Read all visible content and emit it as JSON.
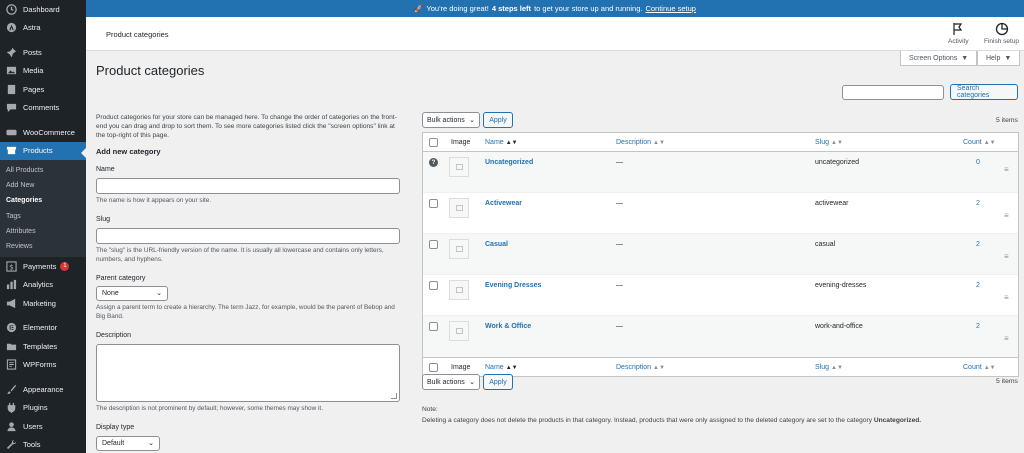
{
  "sidebar": {
    "items": [
      {
        "label": "Dashboard",
        "icon": "dashboard-icon"
      },
      {
        "label": "Astra",
        "icon": "astra-icon"
      },
      {
        "label": "Posts",
        "icon": "pin-icon"
      },
      {
        "label": "Media",
        "icon": "media-icon"
      },
      {
        "label": "Pages",
        "icon": "page-icon"
      },
      {
        "label": "Comments",
        "icon": "comment-icon"
      },
      {
        "label": "WooCommerce",
        "icon": "woocommerce-icon"
      },
      {
        "label": "Products",
        "icon": "archive-icon"
      },
      {
        "label": "Payments",
        "icon": "dollar-icon",
        "badge": "1"
      },
      {
        "label": "Analytics",
        "icon": "bar-chart-icon"
      },
      {
        "label": "Marketing",
        "icon": "megaphone-icon"
      },
      {
        "label": "Elementor",
        "icon": "elementor-icon"
      },
      {
        "label": "Templates",
        "icon": "folder-icon"
      },
      {
        "label": "WPForms",
        "icon": "form-icon"
      },
      {
        "label": "Appearance",
        "icon": "brush-icon"
      },
      {
        "label": "Plugins",
        "icon": "plugin-icon"
      },
      {
        "label": "Users",
        "icon": "user-icon"
      },
      {
        "label": "Tools",
        "icon": "wrench-icon"
      }
    ],
    "products_submenu": [
      "All Products",
      "Add New",
      "Categories",
      "Tags",
      "Attributes",
      "Reviews"
    ]
  },
  "notice": {
    "icon": "rocket-icon",
    "prefix": "You're doing great!",
    "bold": "4 steps left",
    "suffix": "to get your store up and running.",
    "link": "Continue setup"
  },
  "topbar": {
    "breadcrumb": "Product categories",
    "activity": "Activity",
    "finish_setup": "Finish setup"
  },
  "screen_options": "Screen Options",
  "help": "Help",
  "page_title": "Product categories",
  "form": {
    "intro": "Product categories for your store can be managed here. To change the order of categories on the front-end you can drag and drop to sort them. To see more categories listed click the \"screen options\" link at the top-right of this page.",
    "heading": "Add new category",
    "name_label": "Name",
    "name_help": "The name is how it appears on your site.",
    "slug_label": "Slug",
    "slug_help": "The \"slug\" is the URL-friendly version of the name. It is usually all lowercase and contains only letters, numbers, and hyphens.",
    "parent_label": "Parent category",
    "parent_value": "None",
    "parent_help": "Assign a parent term to create a hierarchy. The term Jazz, for example, would be the parent of Bebop and Big Band.",
    "description_label": "Description",
    "description_help": "The description is not prominent by default; however, some themes may show it.",
    "display_type_label": "Display type",
    "display_type_value": "Default"
  },
  "list": {
    "search_button": "Search categories",
    "bulk_actions": "Bulk actions",
    "apply": "Apply",
    "items_count": "5 items",
    "columns": {
      "image": "Image",
      "name": "Name",
      "description": "Description",
      "slug": "Slug",
      "count": "Count"
    },
    "rows": [
      {
        "name": "Uncategorized",
        "description": "—",
        "slug": "uncategorized",
        "count": "0"
      },
      {
        "name": "Activewear",
        "description": "—",
        "slug": "activewear",
        "count": "2"
      },
      {
        "name": "Casual",
        "description": "—",
        "slug": "casual",
        "count": "2"
      },
      {
        "name": "Evening Dresses",
        "description": "—",
        "slug": "evening-dresses",
        "count": "2"
      },
      {
        "name": "Work & Office",
        "description": "—",
        "slug": "work-and-office",
        "count": "2"
      }
    ]
  },
  "note": {
    "title": "Note:",
    "text": "Deleting a category does not delete the products in that category. Instead, products that were only assigned to the deleted category are set to the category",
    "bold": "Uncategorized."
  },
  "colors": {
    "accent": "#2271b1",
    "sidebar": "#1d2327",
    "badge": "#d63638"
  }
}
